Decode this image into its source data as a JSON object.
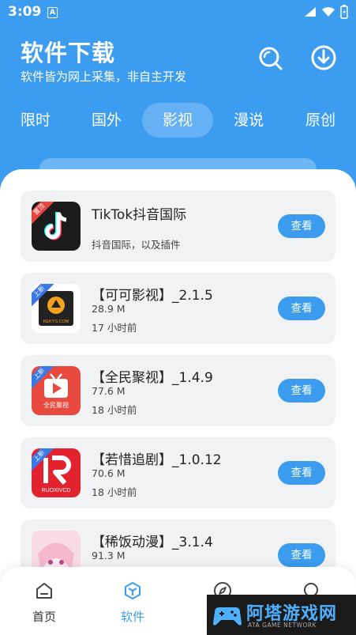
{
  "status_bar": {
    "time": "3:09",
    "notif_glyph": "A"
  },
  "header": {
    "title": "软件下载",
    "subtitle": "软件皆为网上采集，非自主开发",
    "search_icon": "search-icon",
    "download_icon": "download-icon"
  },
  "tabs": [
    {
      "label": "限时",
      "active": false
    },
    {
      "label": "国外",
      "active": false
    },
    {
      "label": "影视",
      "active": true
    },
    {
      "label": "漫说",
      "active": false
    },
    {
      "label": "原创",
      "active": false
    }
  ],
  "apps": [
    {
      "name": "TikTok抖音国际",
      "desc": "抖音国际，以及插件",
      "size": "",
      "time": "",
      "button": "查看",
      "ribbon": "置顶",
      "icon_bg": "#1b1b1b"
    },
    {
      "name": "【可可影视】_2.1.5",
      "desc": "",
      "size": "28.9 M",
      "time": "17 小时前",
      "button": "查看",
      "ribbon": "上新",
      "icon_text": "KEKYS.COM",
      "icon_bg": "#ffffff"
    },
    {
      "name": "【全民聚视】_1.4.9",
      "desc": "",
      "size": "77.6 M",
      "time": "18 小时前",
      "button": "查看",
      "ribbon": "上新",
      "icon_text": "全民聚视",
      "icon_bg": "#e94a3f"
    },
    {
      "name": "【若惜追剧】_1.0.12",
      "desc": "",
      "size": "70.6 M",
      "time": "18 小时前",
      "button": "查看",
      "ribbon": "上新",
      "icon_text": "RUOXIVCD",
      "icon_bg": "#e2232f"
    },
    {
      "name": "【稀饭动漫】_3.1.4",
      "desc": "",
      "size": "91.3 M",
      "time": "",
      "button": "查看",
      "ribbon": "",
      "icon_bg": "#f8dbe6"
    }
  ],
  "bottom_nav": [
    {
      "label": "首页",
      "icon": "home-icon",
      "active": false
    },
    {
      "label": "软件",
      "icon": "software-cube-icon",
      "active": true
    },
    {
      "label": "",
      "icon": "compass-icon",
      "active": false
    },
    {
      "label": "",
      "icon": "profile-icon",
      "active": false
    }
  ],
  "watermark": {
    "title": "阿塔游戏网",
    "subtitle": "ATA GAME NETWORK"
  },
  "colors": {
    "primary": "#3b9cf0",
    "card_bg": "#f1f2f4",
    "text": "#222222"
  }
}
